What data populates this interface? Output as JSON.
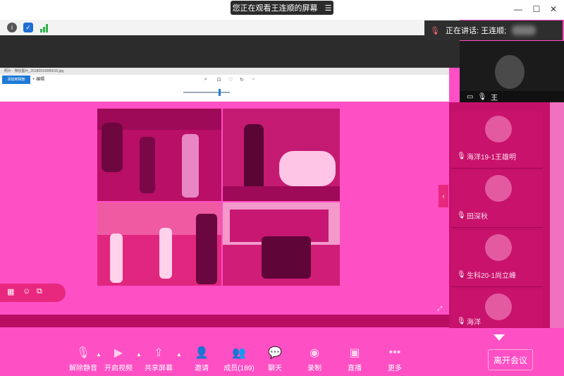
{
  "banner": {
    "text": "您正在观看王连顺的屏幕",
    "menu_icon": "menu-icon"
  },
  "window": {
    "min": "—",
    "max": "☐",
    "close": "✕"
  },
  "speaking": {
    "label": "正在讲话: 王连顺;"
  },
  "self_video": {
    "name": "王"
  },
  "viewer": {
    "title": "照片 - 微信图片_20180916085616.jpg",
    "tab": "添加到相册",
    "add": "+ 编辑"
  },
  "participants": [
    {
      "name": "海洋19-1王雄明"
    },
    {
      "name": "田深秋"
    },
    {
      "name": "生科20-1尚立峰"
    },
    {
      "name": "海洋"
    }
  ],
  "toolbar": {
    "unmute": "解除静音",
    "video": "开启视频",
    "share": "共享屏幕",
    "invite": "邀请",
    "members": "成员(189)",
    "chat": "聊天",
    "record": "录制",
    "live": "直播",
    "more": "更多",
    "leave": "离开会议"
  },
  "colors": {
    "accent": "#ff4fc4",
    "panel": "#c5106a",
    "toolbar_bg": "#ff4fc4"
  }
}
